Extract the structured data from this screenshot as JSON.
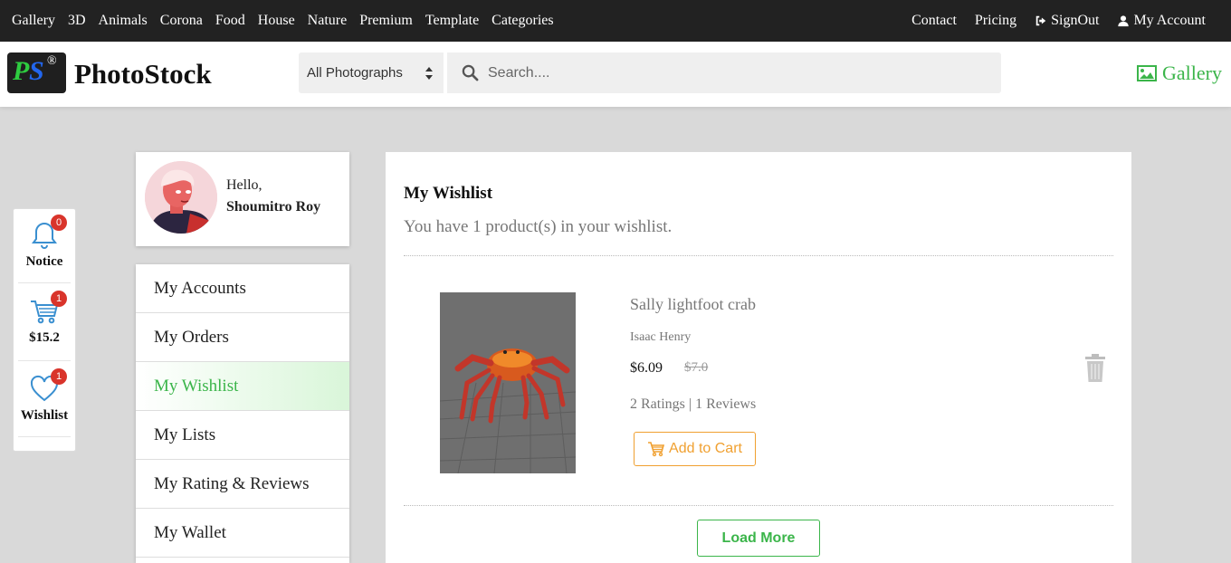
{
  "topnav": {
    "left": [
      "Gallery",
      "3D",
      "Animals",
      "Corona",
      "Food",
      "House",
      "Nature",
      "Premium",
      "Template",
      "Categories"
    ],
    "contact": "Contact",
    "pricing": "Pricing",
    "signout": "SignOut",
    "account": "My Account"
  },
  "header": {
    "logo_p": "P",
    "logo_s": "S",
    "logo_r": "®",
    "brand": "PhotoStock",
    "select_value": "All Photographs",
    "search_placeholder": "Search....",
    "gallery": "Gallery"
  },
  "widget": {
    "notice": {
      "label": "Notice",
      "count": "0"
    },
    "cart": {
      "label": "$15.2",
      "count": "1"
    },
    "wishlist": {
      "label": "Wishlist",
      "count": "1"
    }
  },
  "profile": {
    "hello": "Hello,",
    "name": "Shoumitro Roy"
  },
  "menu": [
    {
      "label": "My Accounts"
    },
    {
      "label": "My Orders"
    },
    {
      "label": "My Wishlist"
    },
    {
      "label": "My Lists"
    },
    {
      "label": "My Rating & Reviews"
    },
    {
      "label": "My Wallet"
    }
  ],
  "wishlist": {
    "title": "My Wishlist",
    "subtitle": "You have 1 product(s) in your wishlist.",
    "product": {
      "name": "Sally lightfoot crab",
      "author": "Isaac Henry",
      "price": "$6.09",
      "old_price": "$7.0",
      "ratings": "2 Ratings | 1 Reviews",
      "cart_label": "Add to Cart"
    },
    "load_more": "Load More"
  },
  "colors": {
    "accent": "#3bb54a",
    "cart": "#f0a030",
    "badge": "#d9342b",
    "nav": "#222222"
  }
}
